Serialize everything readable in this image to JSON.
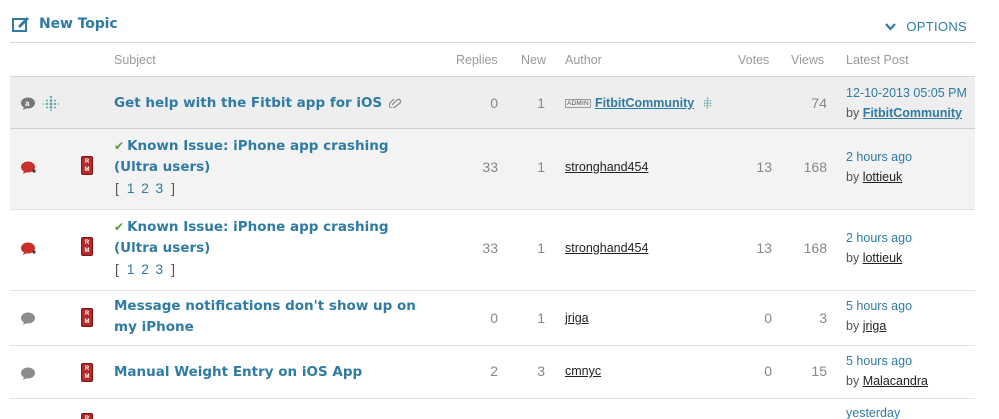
{
  "toolbar": {
    "new_topic_label": "New Topic",
    "options_label": "OPTIONS"
  },
  "columns": {
    "subject": "Subject",
    "replies": "Replies",
    "new": "New",
    "author": "Author",
    "votes": "Votes",
    "views": "Views",
    "latest": "Latest Post"
  },
  "colors": {
    "link": "#2e7ba6",
    "unread_bubble": "#c9302c",
    "read_bubble": "#8c8c8c",
    "rm_badge": "#b52a2a",
    "solved_check": "#5a9a3c"
  },
  "rows": [
    {
      "status_icon": "announcement-bubble-icon",
      "subject": "Get help with the Fitbit app for iOS",
      "has_attachment": true,
      "replies": "0",
      "new": "1",
      "author_tag": "ADMIN",
      "author": "FitbitCommunity",
      "votes": "",
      "views": "74",
      "latest_time": "12-10-2013 05:05 PM",
      "latest_by_label": "by",
      "latest_by": "FitbitCommunity"
    },
    {
      "status_icon": "unread-bubble-icon",
      "subject_prefix": "✔",
      "subject": "Known Issue: iPhone app crashing (Ultra users)",
      "pages_open": "[",
      "pages": [
        "1",
        "2",
        "3"
      ],
      "pages_close": "]",
      "replies": "33",
      "new": "1",
      "author": "stronghand454",
      "votes": "13",
      "views": "168",
      "latest_time": "2 hours ago",
      "latest_by_label": "by",
      "latest_by": "lottieuk"
    },
    {
      "status_icon": "unread-bubble-icon",
      "subject_prefix": "✔",
      "subject": "Known Issue: iPhone app crashing (Ultra users)",
      "pages_open": "[",
      "pages": [
        "1",
        "2",
        "3"
      ],
      "pages_close": "]",
      "replies": "33",
      "new": "1",
      "author": "stronghand454",
      "votes": "13",
      "views": "168",
      "latest_time": "2 hours ago",
      "latest_by_label": "by",
      "latest_by": "lottieuk"
    },
    {
      "status_icon": "read-bubble-icon",
      "subject": "Message notifications don't show up on my iPhone",
      "replies": "0",
      "new": "1",
      "author": "jriga",
      "votes": "0",
      "views": "3",
      "latest_time": "5 hours ago",
      "latest_by_label": "by",
      "latest_by": "jriga"
    },
    {
      "status_icon": "read-bubble-icon",
      "subject": "Manual Weight Entry on iOS App",
      "replies": "2",
      "new": "3",
      "author": "cmnyc",
      "votes": "0",
      "views": "15",
      "latest_time": "5 hours ago",
      "latest_by_label": "by",
      "latest_by": "Malacandra"
    },
    {
      "latest_time": "yesterday"
    }
  ]
}
